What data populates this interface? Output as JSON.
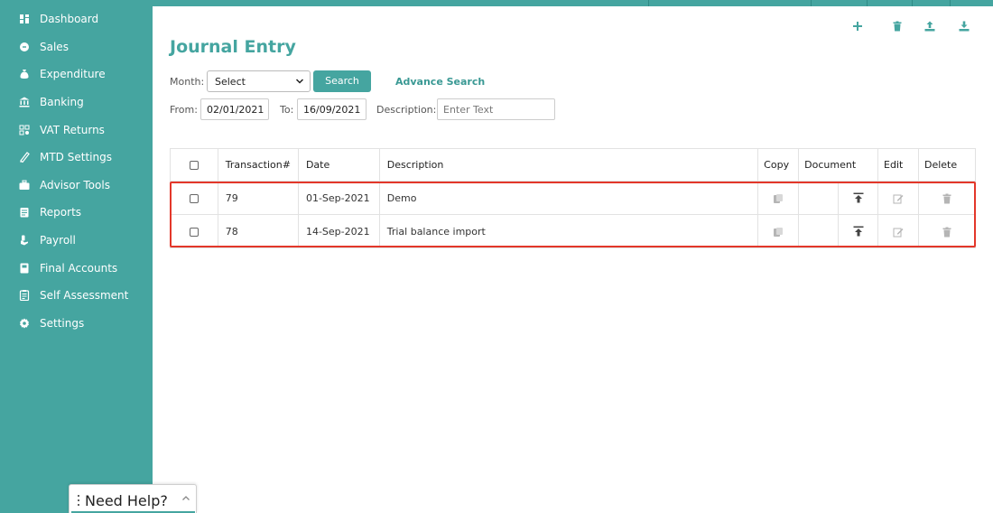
{
  "sidebar": {
    "items": [
      {
        "label": "Dashboard",
        "icon": "dashboard-icon"
      },
      {
        "label": "Sales",
        "icon": "sales-icon"
      },
      {
        "label": "Expenditure",
        "icon": "money-bag-icon"
      },
      {
        "label": "Banking",
        "icon": "bank-icon"
      },
      {
        "label": "VAT Returns",
        "icon": "calculator-icon"
      },
      {
        "label": "MTD Settings",
        "icon": "settings-list-icon"
      },
      {
        "label": "Advisor Tools",
        "icon": "briefcase-icon"
      },
      {
        "label": "Reports",
        "icon": "report-icon"
      },
      {
        "label": "Payroll",
        "icon": "hand-money-icon"
      },
      {
        "label": "Final Accounts",
        "icon": "ledger-icon"
      },
      {
        "label": "Self Assessment",
        "icon": "clipboard-icon"
      },
      {
        "label": "Settings",
        "icon": "gear-icon"
      }
    ]
  },
  "page": {
    "title": "Journal Entry"
  },
  "toolbar": {
    "icons": [
      "plus-icon",
      "trash-icon",
      "upload-icon",
      "download-icon"
    ]
  },
  "filters": {
    "month_label": "Month:",
    "month_value": "Select",
    "search_label": "Search",
    "advance_search": "Advance Search",
    "from_label": "From:",
    "from_value": "02/01/2021",
    "to_label": "To:",
    "to_value": "16/09/2021",
    "description_label": "Description:",
    "description_placeholder": "Enter Text"
  },
  "table": {
    "headers": {
      "transaction": "Transaction#",
      "date": "Date",
      "description": "Description",
      "copy": "Copy",
      "document": "Document",
      "edit": "Edit",
      "delete": "Delete"
    },
    "rows": [
      {
        "transaction": "79",
        "date": "01-Sep-2021",
        "description": "Demo"
      },
      {
        "transaction": "78",
        "date": "14-Sep-2021",
        "description": "Trial balance import"
      }
    ]
  },
  "help": {
    "label": "Need Help?"
  },
  "colors": {
    "brand": "#45a5a0",
    "highlight": "#e3372a"
  }
}
